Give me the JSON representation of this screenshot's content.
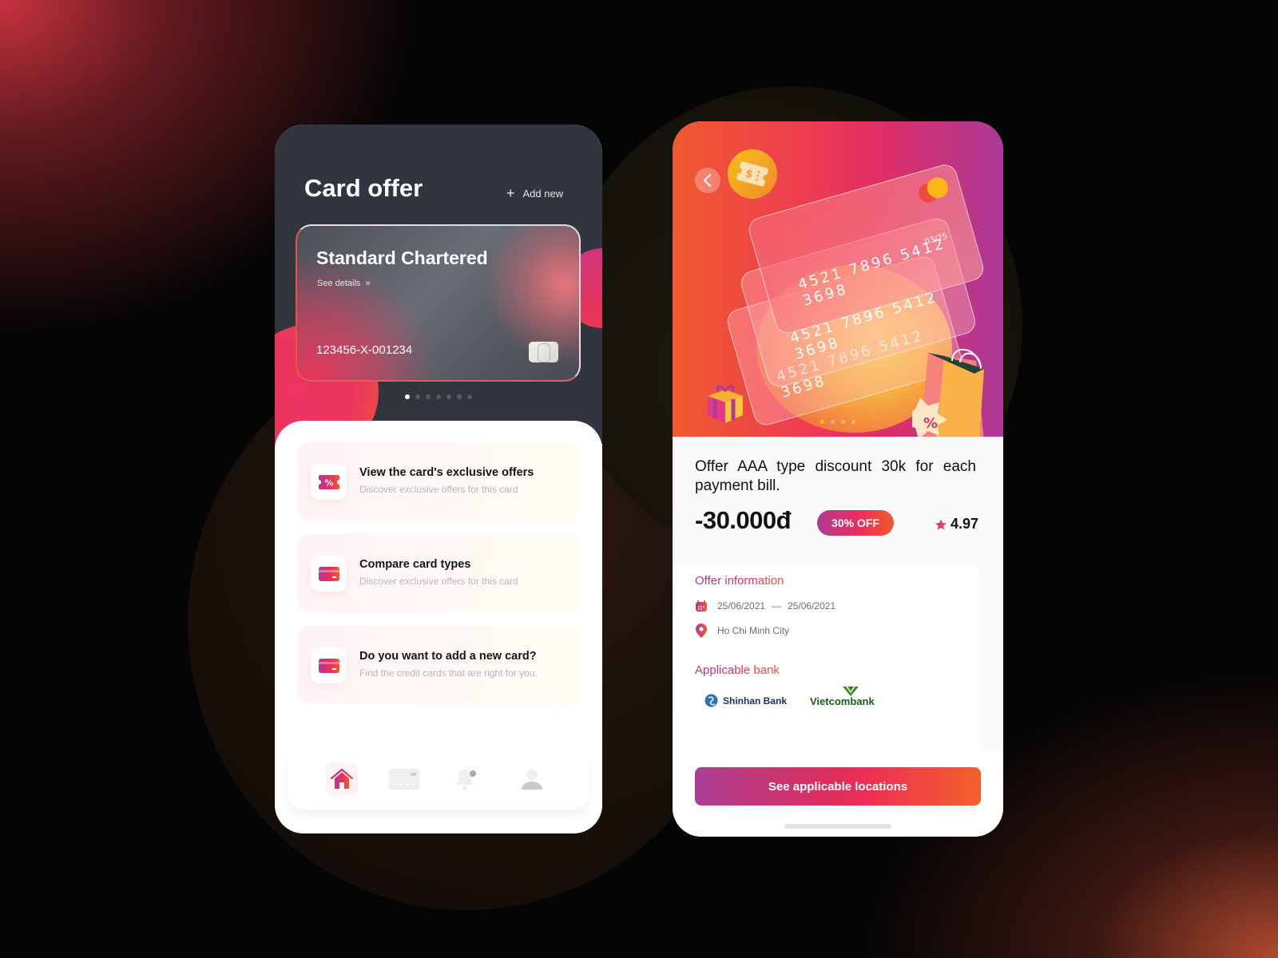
{
  "left_screen": {
    "title": "Card offer",
    "add_new_label": "Add new",
    "card": {
      "bank_name": "Standard Chartered",
      "see_details_label": "See details",
      "card_number": "123456-X-001234"
    },
    "carousel": {
      "total": 7,
      "active_index": 0
    },
    "options": [
      {
        "icon": "coupon-percent-icon",
        "title": "View the card's exclusive offers",
        "subtitle": "Discover exclusive offers for this card"
      },
      {
        "icon": "credit-card-icon",
        "title": "Compare card types",
        "subtitle": "Discover exclusive offers for this card"
      },
      {
        "icon": "credit-card-icon",
        "title": "Do you want to add a new card?",
        "subtitle": "Find the credit cards that are right for you."
      }
    ],
    "nav": [
      {
        "name": "home",
        "icon": "home-icon",
        "active": true
      },
      {
        "name": "cards",
        "icon": "credit-card-icon",
        "active": false
      },
      {
        "name": "notifications",
        "icon": "bell-icon",
        "active": false
      },
      {
        "name": "profile",
        "icon": "user-icon",
        "active": false
      }
    ]
  },
  "right_screen": {
    "hero": {
      "card_numbers": [
        "4521  7896  5412  3698",
        "4521  7896  5412  3698",
        "4521  7896  5412  3698"
      ],
      "card_expiry": "03/25",
      "carousel": {
        "total": 4,
        "active_index": 0
      }
    },
    "offer_title": "Offer AAA type discount 30k for each payment bill.",
    "price": "-30.000đ",
    "discount_badge": "30% OFF",
    "rating": "4.97",
    "offer_info": {
      "heading": "Offer information",
      "date_start": "25/06/2021",
      "date_separator": "—",
      "date_end": "25/06/2021",
      "location": "Ho Chi Minh City"
    },
    "applicable_bank": {
      "heading": "Applicable bank",
      "banks": [
        "Shinhan Bank",
        "Vietcombank"
      ]
    },
    "cta_label": "See applicable locations"
  },
  "colors": {
    "accent_gradient_start": "#a93e93",
    "accent_gradient_mid": "#ec2d5a",
    "accent_gradient_end": "#f2612a",
    "dark_header": "#31353f"
  }
}
